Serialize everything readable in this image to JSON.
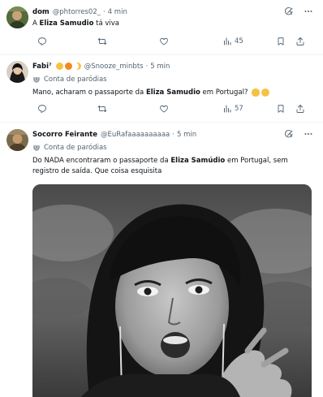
{
  "tweets": [
    {
      "name": "dom",
      "handle": "@phtorres02_",
      "time": "4 min",
      "text_prefix": "A ",
      "text_bold": "Eliza Samudio",
      "text_suffix": " tá viva",
      "views": "45"
    },
    {
      "name": "Fabi⁷",
      "handle": "@Snooze_minbts",
      "time": "5 min",
      "parody_label": "Conta de paródias",
      "text_prefix": "Mano, acharam o passaporte da ",
      "text_bold": "Eliza Samudio",
      "text_suffix": " em Portugal?",
      "views": "57"
    },
    {
      "name": "Socorro Feirante",
      "handle": "@EuRafaaaaaaaaaa",
      "time": "5 min",
      "parody_label": "Conta de paródias",
      "text_prefix": "Do NADA encontraram o passaporte da ",
      "text_bold": "Eliza Samúdio",
      "text_suffix": " em Portugal, sem registro de saída. Que coisa esquisita"
    }
  ],
  "separator": "·",
  "colors": {
    "text": "#0f1419",
    "muted": "#536471",
    "border": "#eff3f4",
    "parody_badge": "#8b98a5"
  },
  "icons": [
    "grok-icon",
    "more-icon",
    "reply-icon",
    "retweet-icon",
    "like-icon",
    "views-icon",
    "bookmark-icon",
    "share-icon",
    "parody-mask-icon"
  ]
}
